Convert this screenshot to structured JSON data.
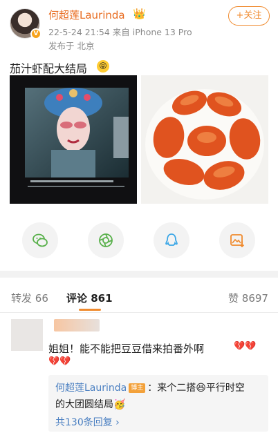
{
  "post": {
    "author": "何超莲Laurinda",
    "crown_icon": "crown-emoji",
    "verified_icon": "verified-v-badge",
    "timestamp": "22-5-24 21:54",
    "source": "来自 iPhone 13 Pro",
    "location": "发布于 北京",
    "follow_label": "+关注",
    "text": "茄汁虾配大结局",
    "text_emoji": "tongue-face-emoji"
  },
  "share": {
    "items": [
      {
        "name": "wechat-icon",
        "color": "#58b04a"
      },
      {
        "name": "moments-icon",
        "color": "#58b04a"
      },
      {
        "name": "qq-icon",
        "color": "#3aa6e6"
      },
      {
        "name": "save-image-icon",
        "color": "#f08a2d"
      }
    ]
  },
  "tabs": {
    "repost_label": "转发",
    "repost_count": "66",
    "comment_label": "评论",
    "comment_count": "861",
    "like_label": "赞",
    "like_count": "8697"
  },
  "comment": {
    "text": "姐姐！能不能把豆豆借来拍番外啊",
    "heart_icon": "broken-heart-emoji",
    "reply": {
      "author": "何超莲Laurinda",
      "badge": "博主",
      "text_a": "：来个二搭",
      "text_b": "平行时空",
      "text_c": "的大团圆结局",
      "more": "共130条回复 ›"
    }
  },
  "colors": {
    "accent": "#f08a2d",
    "link": "#4a7fc1",
    "username": "#e86b1f"
  }
}
